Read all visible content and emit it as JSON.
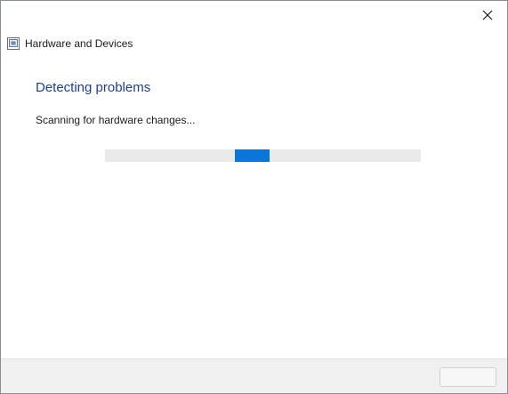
{
  "window": {
    "title": "Hardware and Devices",
    "icon": "troubleshooter-app-icon",
    "close_icon": "close-icon"
  },
  "main": {
    "heading": "Detecting problems",
    "status": "Scanning for hardware changes...",
    "progress": {
      "mode": "indeterminate",
      "segment_start_fraction": 0.41,
      "segment_fraction": 0.11
    }
  },
  "footer": {
    "button_label": ""
  },
  "colors": {
    "heading": "#1e3f8f",
    "progress_fill": "#0a76d8",
    "progress_track": "#eaeaea",
    "footer_bg": "#f0f0f0"
  }
}
